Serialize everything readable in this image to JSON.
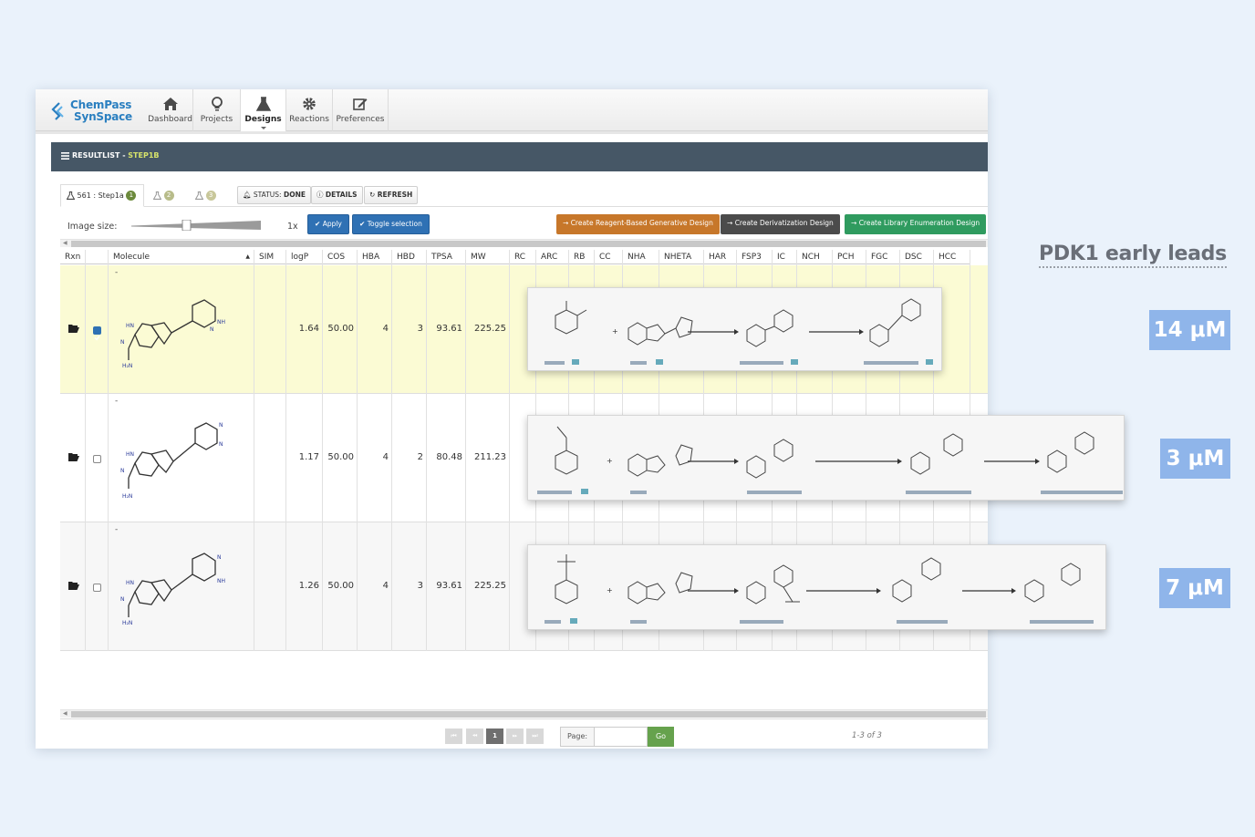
{
  "app": {
    "logo_line1": "ChemPass",
    "logo_line2": "SynSpace",
    "nav": [
      {
        "label": "Dashboard",
        "icon": "home-icon"
      },
      {
        "label": "Projects",
        "icon": "lightbulb-icon"
      },
      {
        "label": "Designs",
        "icon": "flask-icon",
        "active": true
      },
      {
        "label": "Reactions",
        "icon": "gear-icon"
      },
      {
        "label": "Preferences",
        "icon": "edit-icon"
      }
    ]
  },
  "panel": {
    "title_prefix": "RESULTLIST - ",
    "title_step": "STEP1B"
  },
  "tabs": {
    "active_label": "561 : Step1a",
    "active_badge": "1",
    "tab2_badge": "2",
    "tab3_badge": "3"
  },
  "toolbar": {
    "status_prefix": "STATUS: ",
    "status_value": "DONE",
    "details": "DETAILS",
    "refresh": "REFRESH"
  },
  "image_controls": {
    "label": "Image size:",
    "zoom": "1x",
    "apply": "Apply",
    "toggle": "Toggle selection"
  },
  "designs": {
    "reagent": "Create Reagent-Based Generative Design",
    "derivatization": "Create Derivatization Design",
    "library": "Create Library Enumeration Design"
  },
  "table": {
    "columns": [
      "Rxn",
      "",
      "Molecule",
      "SIM",
      "logP",
      "COS",
      "HBA",
      "HBD",
      "TPSA",
      "MW",
      "RC",
      "ARC",
      "RB",
      "CC",
      "NHA",
      "NHETA",
      "HAR",
      "FSP3",
      "IC",
      "NCH",
      "PCH",
      "FGC",
      "DSC",
      "HCC"
    ],
    "rows": [
      {
        "id": "-",
        "selected": true,
        "logP": "1.64",
        "COS": "50.00",
        "HBA": "4",
        "HBD": "3",
        "TPSA": "93.61",
        "MW": "225.25"
      },
      {
        "id": "-",
        "selected": false,
        "logP": "1.17",
        "COS": "50.00",
        "HBA": "4",
        "HBD": "2",
        "TPSA": "80.48",
        "MW": "211.23"
      },
      {
        "id": "-",
        "selected": false,
        "logP": "1.26",
        "COS": "50.00",
        "HBA": "4",
        "HBD": "3",
        "TPSA": "93.61",
        "MW": "225.25"
      }
    ]
  },
  "pager": {
    "current": "1",
    "page_label": "Page:",
    "go": "Go",
    "count": "1-3 of 3"
  },
  "annotations": {
    "title": "PDK1 early leads",
    "ic50": [
      "14 μM",
      "3 μM",
      "7 μM"
    ]
  },
  "colors": {
    "nav_blue": "#2a7fc0",
    "panel_header": "#465766",
    "accent_yellow": "#d7e36b",
    "btn_blue": "#2f71b4",
    "btn_orange": "#c7772a",
    "btn_dark": "#4b4b4b",
    "btn_green": "#2f9b5f",
    "ic50_badge": "#8fb5ea"
  }
}
